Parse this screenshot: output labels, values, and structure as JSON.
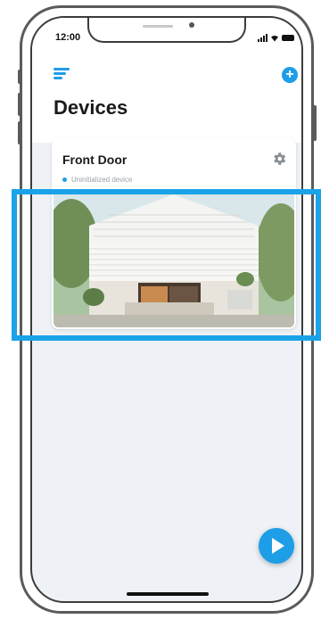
{
  "status_bar": {
    "time": "12:00"
  },
  "header": {
    "title": "Devices"
  },
  "device_card": {
    "name": "Front Door",
    "status": "Uninitialized device"
  },
  "icons": {
    "menu": "hamburger-menu-icon",
    "add": "add-circle-icon",
    "settings": "gear-icon",
    "play": "play-icon"
  },
  "colors": {
    "accent": "#1e9ee6",
    "highlight": "#1aa3e8",
    "background": "#eef1f5"
  }
}
